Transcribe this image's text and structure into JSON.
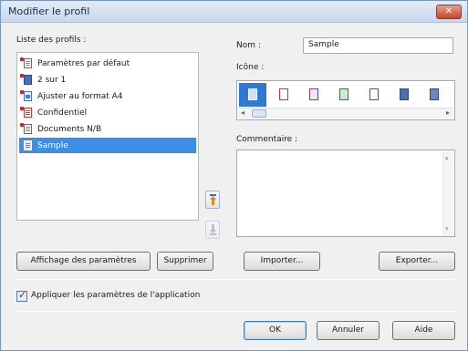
{
  "window": {
    "title": "Modifier le profil",
    "close_glyph": "✕"
  },
  "profiles": {
    "label": "Liste des profils :",
    "items": [
      {
        "label": "Paramètres par défaut",
        "icon": "document-icon"
      },
      {
        "label": "2 sur 1",
        "icon": "two-pages-icon"
      },
      {
        "label": "Ajuster au format A4",
        "icon": "picture-document-icon"
      },
      {
        "label": "Confidentiel",
        "icon": "confidential-document-icon"
      },
      {
        "label": "Documents N/B",
        "icon": "document-icon"
      },
      {
        "label": "Sample",
        "icon": "document-icon",
        "selected": true
      }
    ]
  },
  "form": {
    "name_label": "Nom :",
    "name_value": "Sample",
    "icon_label": "Icône :",
    "comment_label": "Commentaire :"
  },
  "scroll": {
    "left": "◂",
    "right": "▸",
    "up": "▴",
    "down": "▾"
  },
  "buttons": {
    "show_params": "Affichage des paramètres",
    "delete": "Supprimer",
    "import": "Importer...",
    "export": "Exporter...",
    "ok": "OK",
    "cancel": "Annuler",
    "help": "Aide"
  },
  "checkbox": {
    "label": "Appliquer les paramètres de l'application",
    "checked": true,
    "tick": "✓"
  }
}
